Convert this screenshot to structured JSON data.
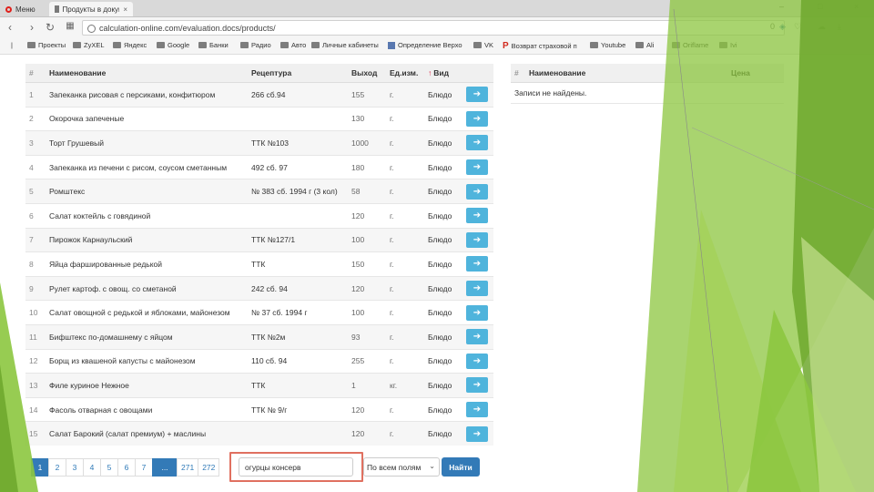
{
  "browser": {
    "menu_label": "Меню",
    "tab_title": "Продукты в документе",
    "url": "calculation-online.com/evaluation.docs/products/",
    "url_badge": "0"
  },
  "bookmarks": [
    {
      "label": "Проекты",
      "icon": "folder-icon"
    },
    {
      "label": "ZyXEL",
      "icon": "folder-icon"
    },
    {
      "label": "Яндекс",
      "icon": "folder-icon"
    },
    {
      "label": "Google",
      "icon": "folder-icon"
    },
    {
      "label": "Банки",
      "icon": "folder-icon"
    },
    {
      "label": "Радио",
      "icon": "folder-icon"
    },
    {
      "label": "Авто",
      "icon": "folder-icon"
    },
    {
      "label": "Личные кабинеты",
      "icon": "folder-icon"
    },
    {
      "label": "Определение Верхо",
      "icon": "image-icon"
    },
    {
      "label": "VK",
      "icon": "folder-icon"
    },
    {
      "label": "Возврат страховой п",
      "icon": "p-icon"
    },
    {
      "label": "Youtube",
      "icon": "folder-icon"
    },
    {
      "label": "Ali",
      "icon": "folder-icon"
    },
    {
      "label": "Oriflame",
      "icon": "folder-icon"
    },
    {
      "label": "Ivi",
      "icon": "folder-icon"
    }
  ],
  "products_table": {
    "headers": {
      "num": "#",
      "name": "Наименование",
      "recipe": "Рецептура",
      "yield": "Выход",
      "unit": "Ед.изм.",
      "kind": "Вид",
      "sort_arrow": "↑"
    },
    "rows": [
      {
        "num": "1",
        "name": "Запеканка рисовая с персиками, конфитюром",
        "recipe": "266 сб.94",
        "yield": "155",
        "unit": "г.",
        "kind": "Блюдо"
      },
      {
        "num": "2",
        "name": "Окорочка запеченые",
        "recipe": "",
        "yield": "130",
        "unit": "г.",
        "kind": "Блюдо"
      },
      {
        "num": "3",
        "name": "Торт Грушевый",
        "recipe": "ТТК №103",
        "yield": "1000",
        "unit": "г.",
        "kind": "Блюдо"
      },
      {
        "num": "4",
        "name": "Запеканка из печени с рисом, соусом сметанным",
        "recipe": "492 сб. 97",
        "yield": "180",
        "unit": "г.",
        "kind": "Блюдо"
      },
      {
        "num": "5",
        "name": "Ромштекс",
        "recipe": "№ 383 сб. 1994 г (3 кол)",
        "yield": "58",
        "unit": "г.",
        "kind": "Блюдо"
      },
      {
        "num": "6",
        "name": "Салат коктейль с говядиной",
        "recipe": "",
        "yield": "120",
        "unit": "г.",
        "kind": "Блюдо"
      },
      {
        "num": "7",
        "name": "Пирожок Карнаульский",
        "recipe": "ТТК №127/1",
        "yield": "100",
        "unit": "г.",
        "kind": "Блюдо"
      },
      {
        "num": "8",
        "name": "Яйца фаршированные редькой",
        "recipe": "ТТК",
        "yield": "150",
        "unit": "г.",
        "kind": "Блюдо"
      },
      {
        "num": "9",
        "name": "Рулет картоф. с овощ. со сметаной",
        "recipe": "242 сб. 94",
        "yield": "120",
        "unit": "г.",
        "kind": "Блюдо"
      },
      {
        "num": "10",
        "name": "Салат овощной с редькой и яблоками, майонезом",
        "recipe": "№ 37 сб. 1994 г",
        "yield": "100",
        "unit": "г.",
        "kind": "Блюдо"
      },
      {
        "num": "11",
        "name": "Бифштекс по-домашнему с яйцом",
        "recipe": "ТТК №2м",
        "yield": "93",
        "unit": "г.",
        "kind": "Блюдо"
      },
      {
        "num": "12",
        "name": "Борщ из квашеной капусты с майонезом",
        "recipe": "110 сб. 94",
        "yield": "255",
        "unit": "г.",
        "kind": "Блюдо"
      },
      {
        "num": "13",
        "name": "Филе куриное Нежное",
        "recipe": "ТТК",
        "yield": "1",
        "unit": "кг.",
        "kind": "Блюдо"
      },
      {
        "num": "14",
        "name": "Фасоль отварная с овощами",
        "recipe": "ТТК № 9/г",
        "yield": "120",
        "unit": "г.",
        "kind": "Блюдо"
      },
      {
        "num": "15",
        "name": "Салат Барокий (салат премиум) + маслины",
        "recipe": "",
        "yield": "120",
        "unit": "г.",
        "kind": "Блюдо"
      }
    ]
  },
  "selected_table": {
    "headers": {
      "num": "#",
      "name": "Наименование",
      "price": "Цена"
    },
    "empty_text": "Записи не найдены."
  },
  "pagination": {
    "pages": [
      "1",
      "2",
      "3",
      "4",
      "5",
      "6",
      "7"
    ],
    "ellipsis": "...",
    "tail": [
      "271",
      "272"
    ],
    "active": "1"
  },
  "search": {
    "value": "огурцы консерв",
    "scope": "По всем полям",
    "button": "Найти"
  },
  "colors": {
    "accent": "#337ab7",
    "arrow_button": "#4fb4dc",
    "highlight_frame": "#e07060",
    "deco_green": "#8cc63f"
  }
}
